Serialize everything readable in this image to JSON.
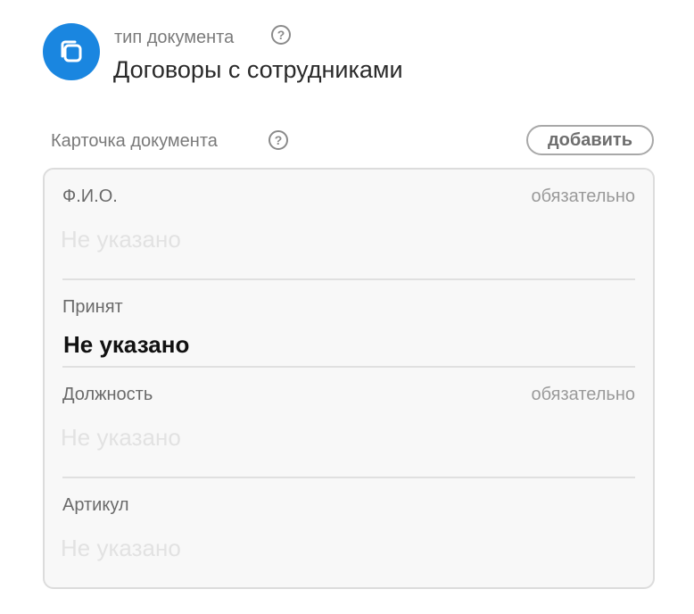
{
  "header": {
    "doc_type_label": "тип документа",
    "doc_type_value": "Договоры с сотрудниками",
    "help_glyph": "?",
    "icon": "copy-icon",
    "icon_color": "#1a86e0"
  },
  "card": {
    "title": "Карточка документа",
    "help_glyph": "?",
    "add_label": "добавить",
    "fields": [
      {
        "label": "Ф.И.О.",
        "required": "обязательно",
        "value": "Не указано",
        "state": "empty"
      },
      {
        "label": "Принят",
        "required": "",
        "value": "Не указано",
        "state": "filled"
      },
      {
        "label": "Должность",
        "required": "обязательно",
        "value": "Не указано",
        "state": "empty"
      },
      {
        "label": "Артикул",
        "required": "",
        "value": "Не указано",
        "state": "empty"
      }
    ]
  }
}
